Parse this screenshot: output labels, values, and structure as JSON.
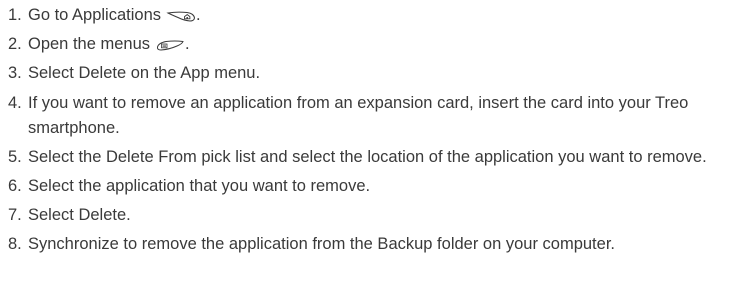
{
  "steps": [
    {
      "num": "1.",
      "text": "Go to Applications",
      "icon": "home-key-icon",
      "suffix": "."
    },
    {
      "num": "2.",
      "text": "Open the menus",
      "icon": "menu-key-icon",
      "suffix": "."
    },
    {
      "num": "3.",
      "text": "Select Delete on the App menu."
    },
    {
      "num": "4.",
      "text": "If you want to remove an application from an expansion card, insert the card into your Treo smartphone."
    },
    {
      "num": "5.",
      "text": "Select the Delete From pick list and select the location of the application you want to remove."
    },
    {
      "num": "6.",
      "text": "Select the application that you want to remove."
    },
    {
      "num": "7.",
      "text": "Select Delete."
    },
    {
      "num": "8.",
      "text": "Synchronize to remove the application from the Backup folder on your computer."
    }
  ]
}
